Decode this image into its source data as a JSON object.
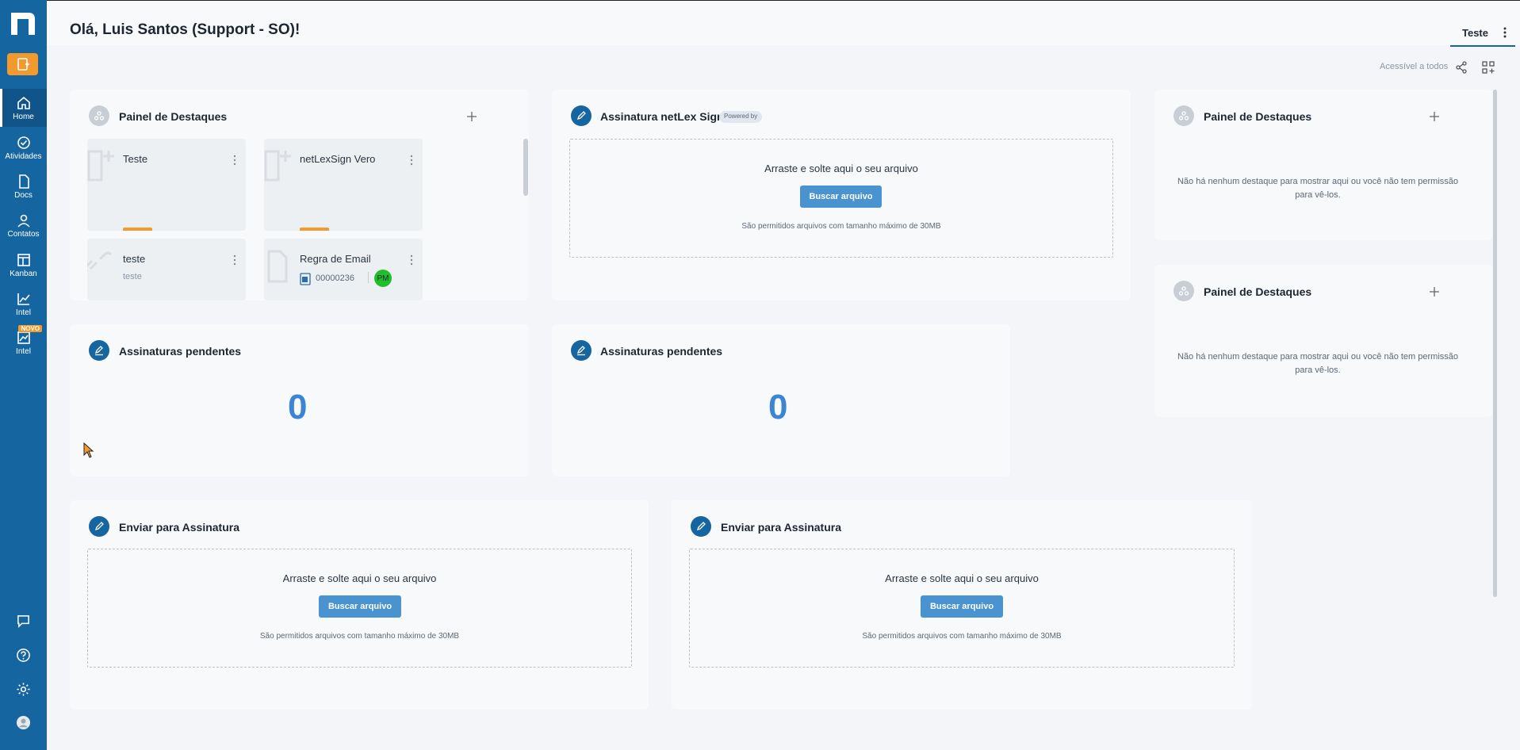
{
  "header": {
    "greeting": "Olá, Luis Santos (Support - SO)!",
    "tab_label": "Teste"
  },
  "toolbar": {
    "visibility": "Acessível a todos"
  },
  "sidebar": {
    "items": [
      {
        "label": "Home",
        "icon": "home-icon"
      },
      {
        "label": "Atividades",
        "icon": "check-circle-icon"
      },
      {
        "label": "Docs",
        "icon": "document-icon"
      },
      {
        "label": "Contatos",
        "icon": "user-icon"
      },
      {
        "label": "Kanban",
        "icon": "kanban-icon"
      },
      {
        "label": "Intel",
        "icon": "chart-icon"
      },
      {
        "label": "Intel",
        "icon": "chart-new-icon",
        "badge": "NOVO"
      }
    ]
  },
  "highlights_main": {
    "title": "Painel de Destaques",
    "tiles": [
      {
        "name": "Teste"
      },
      {
        "name": "netLexSign Vero"
      },
      {
        "name": "teste",
        "sub": "teste"
      },
      {
        "name": "Regra de Email",
        "code": "00000236",
        "avatar": "PM"
      }
    ]
  },
  "sign_panel": {
    "title": "Assinatura netLex Sign",
    "powered": "Powered by",
    "drop_text": "Arraste e solte aqui o seu arquivo",
    "button": "Buscar arquivo",
    "note": "São permitidos arquivos com tamanho máximo de 30MB"
  },
  "highlights_right_1": {
    "title": "Painel de Destaques",
    "empty": "Não há nenhum destaque para mostrar aqui ou você não tem permissão para vê-los."
  },
  "highlights_right_2": {
    "title": "Painel de Destaques",
    "empty": "Não há nenhum destaque para mostrar aqui ou você não tem permissão para vê-los."
  },
  "pending_1": {
    "title": "Assinaturas pendentes",
    "count": "0"
  },
  "pending_2": {
    "title": "Assinaturas pendentes",
    "count": "0"
  },
  "send_1": {
    "title": "Enviar para Assinatura",
    "drop_text": "Arraste e solte aqui o seu arquivo",
    "button": "Buscar arquivo",
    "note": "São permitidos arquivos com tamanho máximo de 30MB"
  },
  "send_2": {
    "title": "Enviar para Assinatura",
    "drop_text": "Arraste e solte aqui o seu arquivo",
    "button": "Buscar arquivo",
    "note": "São permitidos arquivos com tamanho máximo de 30MB"
  },
  "colors": {
    "sidebar": "#1565a0",
    "accent_orange": "#f29a2e",
    "button_blue": "#4a93d1",
    "count_blue": "#3a85d6"
  }
}
